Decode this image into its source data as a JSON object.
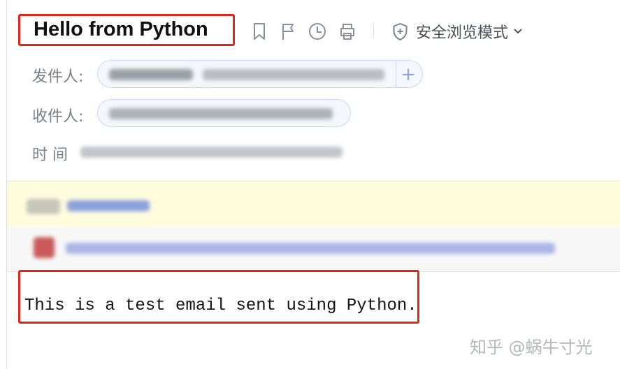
{
  "email": {
    "subject": "Hello from Python",
    "body_text": "This is a test email sent using Python."
  },
  "toolbar": {
    "secure_browsing_label": "安全浏览模式",
    "icons": [
      "bookmark-icon",
      "flag-icon",
      "clock-icon",
      "print-icon",
      "shield-plus-icon",
      "chevron-down-icon"
    ]
  },
  "meta": {
    "from_label": "发件人:",
    "to_label": "收件人:",
    "time_label": "时 间",
    "add_symbol": "+"
  },
  "watermark": {
    "text": "知乎 @蜗牛寸光"
  },
  "colors": {
    "highlight_box": "#e0251b",
    "attachment_band": "#fffbdd",
    "pill_border": "#c9d6ee"
  }
}
